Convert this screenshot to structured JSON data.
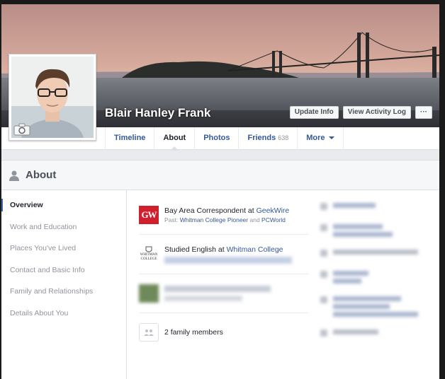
{
  "profile": {
    "name": "Blair Hanley Frank"
  },
  "cover_buttons": {
    "update_info": "Update Info",
    "view_activity_log": "View Activity Log",
    "more": "···"
  },
  "tabs": [
    {
      "label": "Timeline"
    },
    {
      "label": "About"
    },
    {
      "label": "Photos"
    },
    {
      "label": "Friends",
      "count": "638"
    },
    {
      "label": "More"
    }
  ],
  "about": {
    "title": "About",
    "sidebar": [
      "Overview",
      "Work and Education",
      "Places You've Lived",
      "Contact and Basic Info",
      "Family and Relationships",
      "Details About You"
    ],
    "work": {
      "logo_text": "GW",
      "title_prefix": "Bay Area Correspondent at ",
      "employer": "GeekWire",
      "past_label": "Past: ",
      "past1": "Whitman College Pioneer",
      "and": " and ",
      "past2": "PCWorld"
    },
    "education": {
      "logo_line1": "WHITMAN",
      "logo_line2": "COLLEGE",
      "prefix": "Studied English at ",
      "school": "Whitman College"
    },
    "family": {
      "label": "2 family members"
    }
  },
  "colors": {
    "link": "#365899",
    "accent": "#4267b2",
    "gw_red": "#d0202e"
  }
}
